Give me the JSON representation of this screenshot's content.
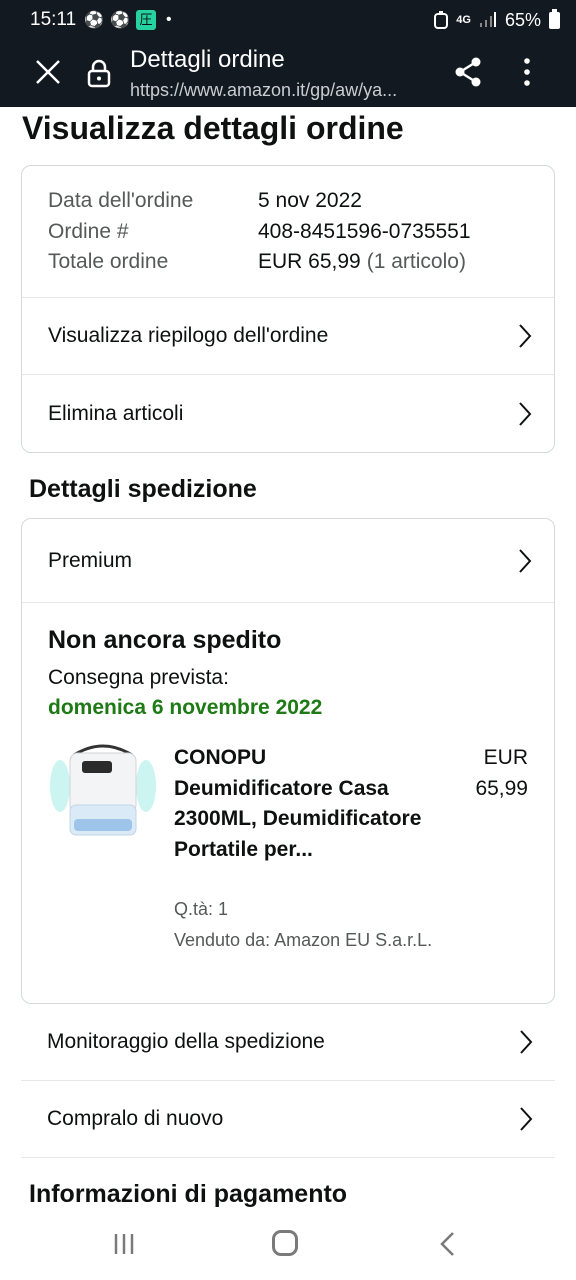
{
  "status_bar": {
    "time": "15:11",
    "network": "4G",
    "battery": "65%",
    "icons": [
      "soccer-ball-icon",
      "soccer-ball-icon",
      "app-icon",
      "dot-icon",
      "alarm-icon",
      "network-icon",
      "signal-icon",
      "battery-icon"
    ],
    "app_glyph": "圧"
  },
  "browser": {
    "title": "Dettagli ordine",
    "url": "https://www.amazon.it/gp/aw/ya..."
  },
  "page": {
    "title": "Visualizza dettagli ordine"
  },
  "order": {
    "rows": [
      {
        "label": "Data dell'ordine",
        "value": "5 nov 2022",
        "extra": ""
      },
      {
        "label": "Ordine #",
        "value": "408-8451596-0735551",
        "extra": ""
      },
      {
        "label": "Totale ordine",
        "value": "EUR 65,99",
        "extra": "(1 articolo)"
      }
    ],
    "summary_link": "Visualizza riepilogo dell'ordine",
    "delete_link": "Elimina articoli"
  },
  "shipping": {
    "section_title": "Dettagli spedizione",
    "method": "Premium",
    "status": "Non ancora spedito",
    "delivery_label": "Consegna prevista:",
    "delivery_date": "domenica 6 novembre 2022",
    "product": {
      "name": "CONOPU Deumidificatore Casa 2300ML, Deumidificatore Portatile per...",
      "price": "EUR 65,99",
      "qty": "Q.tà: 1",
      "seller": "Venduto da: Amazon EU S.a.r.L."
    },
    "track_link": "Monitoraggio della spedizione",
    "buy_again_link": "Compralo di nuovo"
  },
  "payment": {
    "section_title": "Informazioni di pagamento"
  },
  "colors": {
    "header_bg": "#131921",
    "delivery_green": "#1d7a15",
    "muted_text": "#565959"
  }
}
